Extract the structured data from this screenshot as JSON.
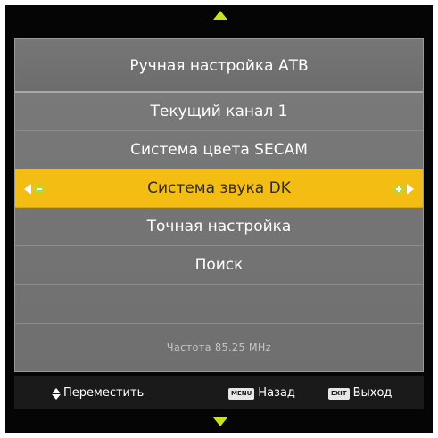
{
  "menu": {
    "title": "Ручная настройка АТВ",
    "items": [
      {
        "label": "Текущий канал 1"
      },
      {
        "label": "Система цвета SECAM"
      },
      {
        "label": "Система звука DK"
      },
      {
        "label": "Точная настройка"
      },
      {
        "label": "Поиск"
      }
    ],
    "selected_index": 2,
    "frequency": "Частота  85.25 MHz"
  },
  "footer": {
    "move_label": "Переместить",
    "menu_key": "MENU",
    "back_label": "Назад",
    "exit_key": "EXIT",
    "exit_label": "Выход"
  },
  "icons": {
    "scroll_up": "triangle-up-icon",
    "scroll_down": "triangle-down-icon",
    "decrease": "minus-left-icon",
    "increase": "plus-right-icon",
    "move": "up-down-arrows-icon"
  },
  "colors": {
    "highlight": "#f3bd14",
    "accent": "#c9e21c",
    "panel": "#757575",
    "background": "#050505"
  }
}
